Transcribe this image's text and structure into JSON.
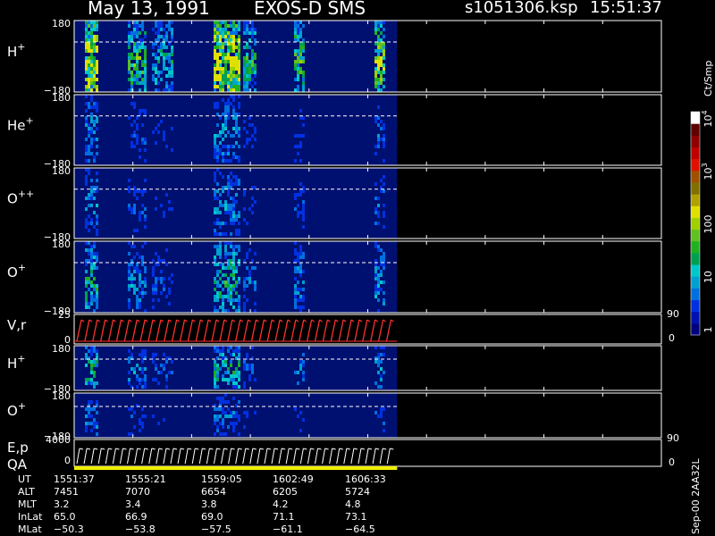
{
  "header": {
    "date": "May 13, 1991",
    "instrument": "EXOS-D SMS",
    "file": "s1051306.ksp",
    "time": "15:51:37"
  },
  "colorbar": {
    "unit": "Ct/Smp",
    "ticks": [
      "1",
      "10",
      "100",
      "10^3",
      "10^4"
    ],
    "tick_values": [
      1,
      10,
      100,
      1000,
      10000
    ],
    "colors": [
      "#000080",
      "#0010b0",
      "#0030e0",
      "#0070e0",
      "#00a0d0",
      "#00c8c8",
      "#00a050",
      "#20b020",
      "#60c020",
      "#a0d000",
      "#e0e000",
      "#b0a000",
      "#807000",
      "#a05000",
      "#e01000",
      "#c00000",
      "#900000",
      "#600000",
      "#ffffff"
    ]
  },
  "chart_data": {
    "type": "heatmap",
    "panels": [
      {
        "species_base": "H",
        "charge": "+",
        "ylim": [
          -180,
          180
        ],
        "ytop": "180",
        "ybot": "−180"
      },
      {
        "species_base": "He",
        "charge": "+",
        "ylim": [
          -180,
          180
        ],
        "ytop": "180",
        "ybot": "−180"
      },
      {
        "species_base": "O",
        "charge": "++",
        "ylim": [
          -180,
          180
        ],
        "ytop": "180",
        "ybot": "−180"
      },
      {
        "species_base": "O",
        "charge": "+",
        "ylim": [
          -180,
          180
        ],
        "ytop": "180",
        "ybot": "−180"
      },
      {
        "species_base": "H",
        "charge": "+",
        "ylim": [
          -180,
          180
        ],
        "ytop": "180",
        "ybot": "−180"
      },
      {
        "species_base": "O",
        "charge": "+",
        "ylim": [
          -180,
          180
        ],
        "ytop": "180",
        "ybot": "−180"
      }
    ],
    "vr_panel": {
      "label": "V,r",
      "ytop": "25",
      "ybot": "0",
      "rtop": "90",
      "rbot": "0"
    },
    "ep_panel": {
      "label1": "E,p",
      "label2": "QA",
      "ytop": "4000",
      "ybot": "0",
      "rtop": "90",
      "rbot": "0"
    },
    "time_axis": {
      "start": "15:51:37",
      "end": "16:10:17",
      "ticks": [
        "1551:37",
        "1555:21",
        "1559:05",
        "1602:49",
        "1606:33"
      ]
    },
    "data_end_fraction": 0.55,
    "side_label": "Sep-00 2AA32L"
  },
  "ephemeris": [
    {
      "name": "UT",
      "values": [
        "1551:37",
        "1555:21",
        "1559:05",
        "1602:49",
        "1606:33"
      ]
    },
    {
      "name": "ALT",
      "values": [
        "7451",
        "7070",
        "6654",
        "6205",
        "5724"
      ]
    },
    {
      "name": "MLT",
      "values": [
        "3.2",
        "3.4",
        "3.8",
        "4.2",
        "4.8"
      ]
    },
    {
      "name": "InLat",
      "values": [
        "65.0",
        "66.9",
        "69.0",
        "71.1",
        "73.1"
      ]
    },
    {
      "name": "MLat",
      "values": [
        "-50.3",
        "-53.8",
        "-57.5",
        "-61.1",
        "-64.5"
      ]
    }
  ]
}
